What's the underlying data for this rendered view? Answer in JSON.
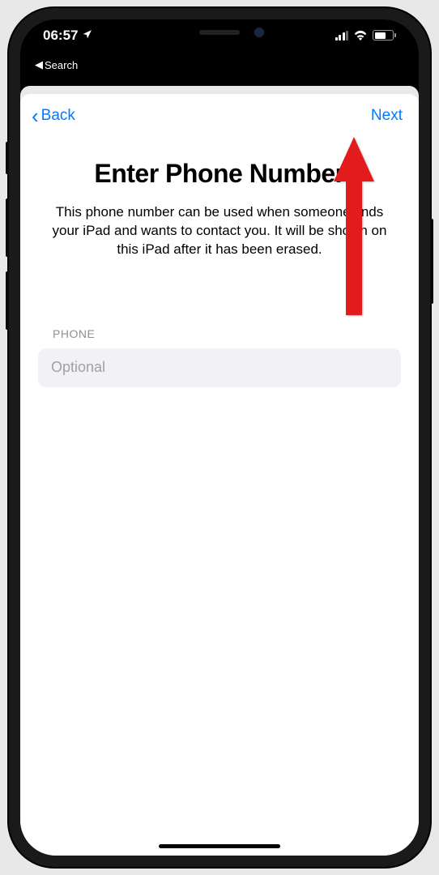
{
  "statusbar": {
    "time": "06:57",
    "breadcrumb_app": "Search"
  },
  "nav": {
    "back_label": "Back",
    "next_label": "Next"
  },
  "page": {
    "title": "Enter Phone Number",
    "description": "This phone number can be used when someone finds your iPad and wants to contact you. It will be shown on this iPad after it has been erased."
  },
  "form": {
    "phone_label": "PHONE",
    "phone_placeholder": "Optional",
    "phone_value": ""
  }
}
